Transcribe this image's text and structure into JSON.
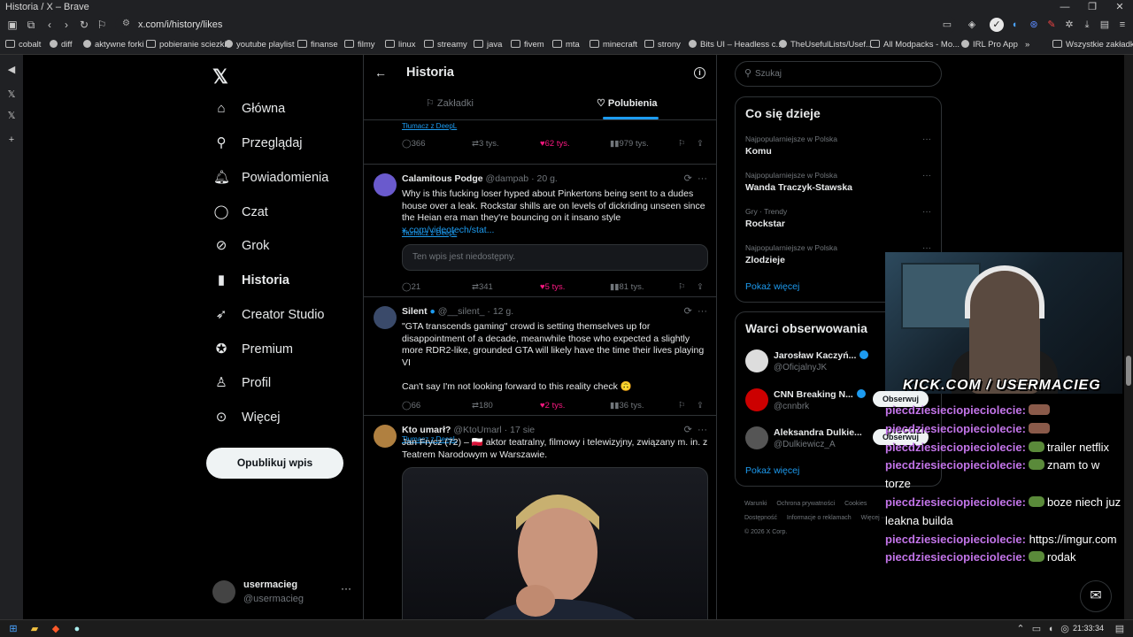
{
  "window": {
    "title": "Historia / X – Brave"
  },
  "browser": {
    "url": "x.com/i/history/likes",
    "bookmarks": [
      "cobalt",
      "diff",
      "aktywne forki",
      "pobieranie sciezki",
      "youtube playlist",
      "finanse",
      "filmy",
      "linux",
      "streamy",
      "java",
      "fivem",
      "mta",
      "minecraft",
      "strony",
      "Bits UI – Headless c...",
      "TheUsefulLists/Usef...",
      "All Modpacks - Mo...",
      "IRL Pro App",
      "Wszystkie zakładki"
    ],
    "overflow": "»"
  },
  "nav": {
    "items": [
      {
        "label": "Główna",
        "icon": "home-icon"
      },
      {
        "label": "Przeglądaj",
        "icon": "search-icon"
      },
      {
        "label": "Powiadomienia",
        "icon": "bell-icon"
      },
      {
        "label": "Czat",
        "icon": "chat-icon"
      },
      {
        "label": "Grok",
        "icon": "grok-icon"
      },
      {
        "label": "Historia",
        "icon": "bookmark-icon"
      },
      {
        "label": "Creator Studio",
        "icon": "rocket-icon"
      },
      {
        "label": "Premium",
        "icon": "verified-icon"
      },
      {
        "label": "Profil",
        "icon": "person-icon"
      },
      {
        "label": "Więcej",
        "icon": "more-icon"
      }
    ],
    "post_label": "Opublikuj wpis",
    "account": {
      "name": "usermacieg",
      "handle": "@usermacieg",
      "more": "···"
    }
  },
  "center": {
    "title": "Historia",
    "tabs": [
      {
        "label": "Zakładki",
        "active": false
      },
      {
        "label": "Polubienia",
        "active": true
      }
    ],
    "partial_tweet": {
      "translate": "Tłumacz z DeepL",
      "metrics": {
        "replies": "366",
        "retweets": "3 tys.",
        "likes": "62 tys.",
        "views": "979 tys."
      }
    },
    "tweets": [
      {
        "name": "Calamitous Podge",
        "handle": "@dampab",
        "time": "· 20 g.",
        "text": "Why is this fucking loser hyped about Pinkertons being sent to a dudes house over a leak. Rockstar shills are on levels of dickriding unseen since the Heian era man they're bouncing on it insano style",
        "link": "x.com/videotech/stat...",
        "translate": "Tłumacz z DeepL",
        "unavailable": "Ten wpis jest niedostępny.",
        "metrics": {
          "replies": "21",
          "retweets": "341",
          "likes": "5 tys.",
          "views": "81 tys."
        }
      },
      {
        "name": "Silent",
        "handle": "@__silent_",
        "time": "· 12 g.",
        "text": "\"GTA transcends gaming\" crowd is setting themselves up for disappointment of a decade, meanwhile those who expected a slightly more RDR2-like, grounded GTA will likely have the time their lives playing VI",
        "text2": "Can't say I'm not looking forward to this reality check 🙃",
        "translate": "Tłumacz z DeepL",
        "metrics": {
          "replies": "66",
          "retweets": "180",
          "likes": "2 tys.",
          "views": "36 tys."
        }
      },
      {
        "name": "Kto umarł?",
        "handle": "@KtoUmarl",
        "time": "· 17 sie",
        "text": "Jan Frycz (72) – 🇵🇱 aktor teatralny, filmowy i telewizyjny, związany m. in. z Teatrem Narodowym w Warszawie."
      }
    ]
  },
  "right": {
    "search_placeholder": "Szukaj",
    "trends": {
      "title": "Co się dzieje",
      "items": [
        {
          "meta": "Najpopularniejsze w Polska",
          "topic": "Komu"
        },
        {
          "meta": "Najpopularniejsze w Polska",
          "topic": "Wanda Traczyk-Stawska"
        },
        {
          "meta": "Gry · Trendy",
          "topic": "Rockstar"
        },
        {
          "meta": "Najpopularniejsze w Polska",
          "topic": "Zlodzieje"
        }
      ],
      "more": "Pokaż więcej"
    },
    "who": {
      "title": "Warci obserwowania",
      "items": [
        {
          "name": "Jarosław Kaczyń...",
          "handle": "@OficjalnyJK"
        },
        {
          "name": "CNN Breaking N...",
          "handle": "@cnnbrk",
          "follow": "Obserwuj"
        },
        {
          "name": "Aleksandra Dulkie...",
          "handle": "@Dulkiewicz_A",
          "follow": "Obserwuj"
        }
      ],
      "more": "Pokaż więcej"
    },
    "footer": [
      "Warunki",
      "Ochrona prywatności",
      "Cookies",
      "Dostępność",
      "Informacje o reklamach",
      "Więcej ···",
      "© 2026 X Corp."
    ]
  },
  "overlay": {
    "kick": "KICK.COM / USERMACIEG",
    "chat": [
      {
        "user": "piecdziesieciopieciolecie:",
        "msg": "",
        "emote": "emote2"
      },
      {
        "user": "piecdziesieciopieciolecie:",
        "msg": "",
        "emote": "emote2"
      },
      {
        "user": "piecdziesieciopieciolecie:",
        "msg": "trailer netflix",
        "emote": "emote1"
      },
      {
        "user": "piecdziesieciopieciolecie:",
        "msg": "znam to w torze",
        "emote": "emote1"
      },
      {
        "user": "piecdziesieciopieciolecie:",
        "msg": "boze niech juz leakna builda",
        "emote": "emote1"
      },
      {
        "user": "piecdziesieciopieciolecie:",
        "msg": "https://imgur.com",
        "emote": ""
      },
      {
        "user": "piecdziesieciopieciolecie:",
        "msg": "rodak",
        "emote": "emote1"
      }
    ]
  },
  "taskbar": {
    "clock": "21:33:34"
  }
}
